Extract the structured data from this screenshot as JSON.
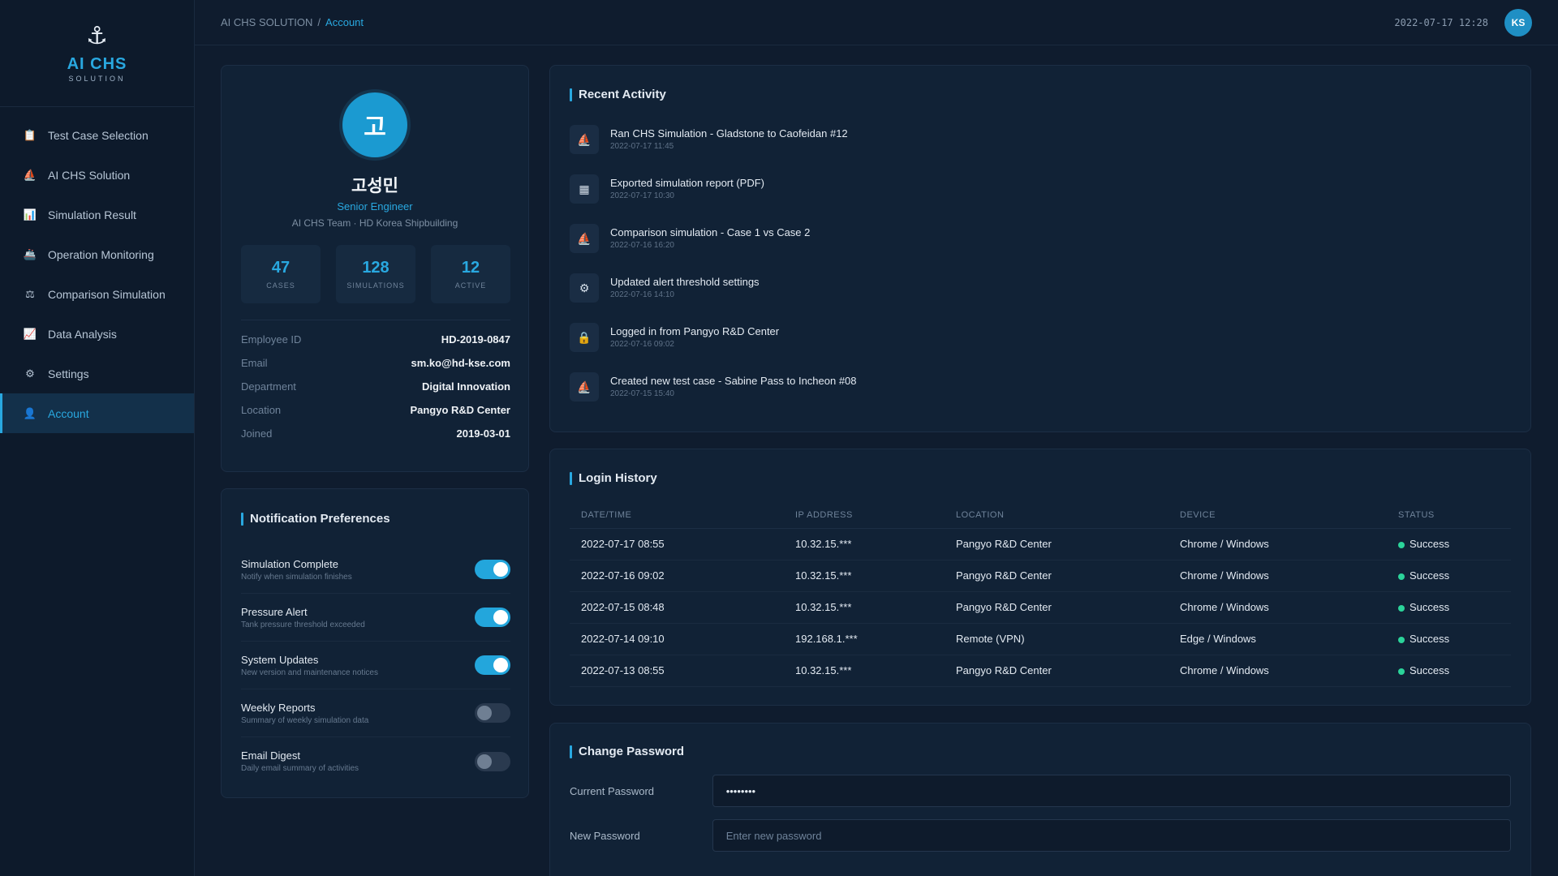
{
  "sidebar": {
    "logo_title": "AI CHS",
    "logo_subtitle": "SOLUTION",
    "items": [
      {
        "label": "Test Case Selection",
        "icon": "clipboard-icon"
      },
      {
        "label": "AI CHS Solution",
        "icon": "ship-icon"
      },
      {
        "label": "Simulation Result",
        "icon": "bar-chart-icon"
      },
      {
        "label": "Operation Monitoring",
        "icon": "vessel-icon"
      },
      {
        "label": "Comparison Simulation",
        "icon": "scale-icon"
      },
      {
        "label": "Data Analysis",
        "icon": "line-chart-icon"
      },
      {
        "label": "Settings",
        "icon": "gear-icon"
      },
      {
        "label": "Account",
        "icon": "user-icon"
      }
    ],
    "active_index": 7
  },
  "header": {
    "breadcrumb_root": "AI CHS SOLUTION",
    "breadcrumb_sep": "/",
    "breadcrumb_current": "Account",
    "datetime": "2022-07-17 12:28",
    "user_initials": "KS"
  },
  "profile": {
    "avatar_char": "고",
    "name": "고성민",
    "role": "Senior Engineer",
    "team": "AI CHS Team · HD Korea Shipbuilding",
    "stats": [
      {
        "value": "47",
        "label": "CASES"
      },
      {
        "value": "128",
        "label": "SIMULATIONS"
      },
      {
        "value": "12",
        "label": "ACTIVE"
      }
    ],
    "info": [
      {
        "key": "Employee ID",
        "value": "HD-2019-0847"
      },
      {
        "key": "Email",
        "value": "sm.ko@hd-kse.com"
      },
      {
        "key": "Department",
        "value": "Digital Innovation"
      },
      {
        "key": "Location",
        "value": "Pangyo R&D Center"
      },
      {
        "key": "Joined",
        "value": "2019-03-01"
      }
    ]
  },
  "notifications": {
    "title": "Notification Preferences",
    "items": [
      {
        "title": "Simulation Complete",
        "desc": "Notify when simulation finishes",
        "on": true
      },
      {
        "title": "Pressure Alert",
        "desc": "Tank pressure threshold exceeded",
        "on": true
      },
      {
        "title": "System Updates",
        "desc": "New version and maintenance notices",
        "on": true
      },
      {
        "title": "Weekly Reports",
        "desc": "Summary of weekly simulation data",
        "on": false
      },
      {
        "title": "Email Digest",
        "desc": "Daily email summary of activities",
        "on": false
      }
    ]
  },
  "activity": {
    "title": "Recent Activity",
    "items": [
      {
        "icon": "ship-icon",
        "glyph": "⛵",
        "title": "Ran CHS Simulation - Gladstone to Caofeidan #12",
        "time": "2022-07-17 11:45"
      },
      {
        "icon": "bar-chart-icon",
        "glyph": "▦",
        "title": "Exported simulation report (PDF)",
        "time": "2022-07-17 10:30"
      },
      {
        "icon": "ship-icon",
        "glyph": "⛵",
        "title": "Comparison simulation - Case 1 vs Case 2",
        "time": "2022-07-16 16:20"
      },
      {
        "icon": "gear-icon",
        "glyph": "⚙",
        "title": "Updated alert threshold settings",
        "time": "2022-07-16 14:10"
      },
      {
        "icon": "lock-icon",
        "glyph": "🔒",
        "title": "Logged in from Pangyo R&D Center",
        "time": "2022-07-16 09:02"
      },
      {
        "icon": "ship-icon",
        "glyph": "⛵",
        "title": "Created new test case - Sabine Pass to Incheon #08",
        "time": "2022-07-15 15:40"
      }
    ]
  },
  "history": {
    "title": "Login History",
    "columns": [
      "DATE/TIME",
      "IP ADDRESS",
      "LOCATION",
      "DEVICE",
      "STATUS"
    ],
    "rows": [
      [
        "2022-07-17 08:55",
        "10.32.15.***",
        "Pangyo R&D Center",
        "Chrome / Windows",
        "Success"
      ],
      [
        "2022-07-16 09:02",
        "10.32.15.***",
        "Pangyo R&D Center",
        "Chrome / Windows",
        "Success"
      ],
      [
        "2022-07-15 08:48",
        "10.32.15.***",
        "Pangyo R&D Center",
        "Chrome / Windows",
        "Success"
      ],
      [
        "2022-07-14 09:10",
        "192.168.1.***",
        "Remote (VPN)",
        "Edge / Windows",
        "Success"
      ],
      [
        "2022-07-13 08:55",
        "10.32.15.***",
        "Pangyo R&D Center",
        "Chrome / Windows",
        "Success"
      ]
    ]
  },
  "password": {
    "title": "Change Password",
    "current_label": "Current Password",
    "current_value": "••••••••",
    "new_label": "New Password",
    "new_placeholder": "Enter new password"
  },
  "colors": {
    "accent": "#29a8e0",
    "background": "#0f1c2e",
    "card": "#112236",
    "success": "#2bd49a"
  }
}
